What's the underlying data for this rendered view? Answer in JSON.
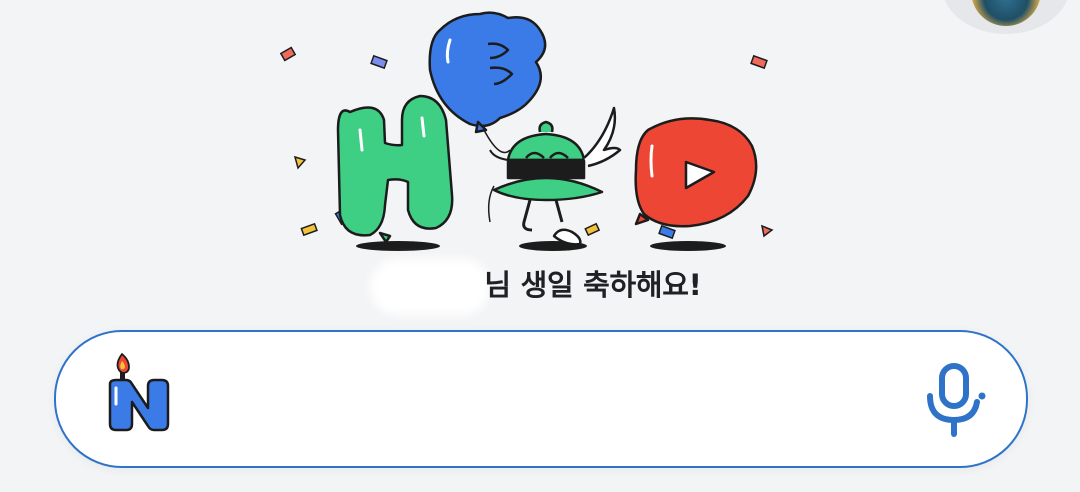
{
  "greeting": {
    "text": "님 생일 축하해요!"
  },
  "doodle": {
    "balloons": [
      "H",
      "B",
      "D"
    ]
  },
  "search": {
    "value": "",
    "placeholder": ""
  },
  "colors": {
    "accent": "#2f73c8",
    "balloon_h": "#3ecf85",
    "balloon_b": "#3b7be8",
    "balloon_d": "#ee4634",
    "background": "#f3f4f6"
  },
  "icons": {
    "logo": "naver-n-candle-icon",
    "voice": "microphone-icon",
    "profile": "avatar"
  }
}
